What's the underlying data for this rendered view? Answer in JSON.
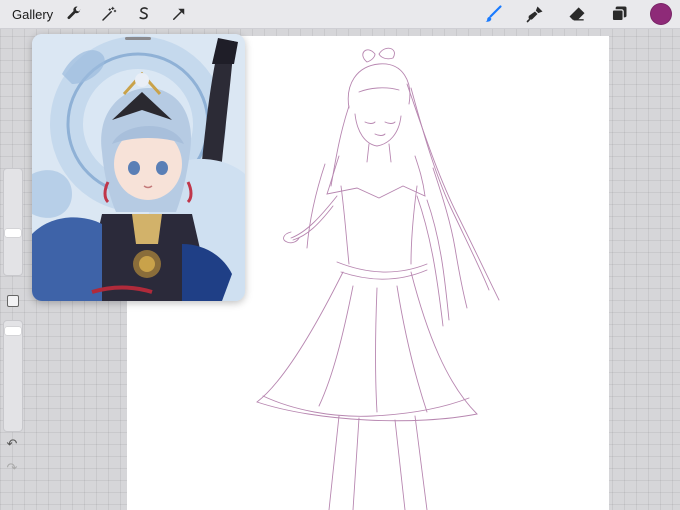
{
  "topbar": {
    "gallery_label": "Gallery",
    "left_tools": [
      {
        "name": "wrench-icon",
        "action": "actions"
      },
      {
        "name": "magic-wand-icon",
        "action": "adjustments"
      },
      {
        "name": "selection-s-icon",
        "action": "selection"
      },
      {
        "name": "arrow-cursor-icon",
        "action": "transform"
      }
    ],
    "right_tools": [
      {
        "name": "brush-icon",
        "active": true
      },
      {
        "name": "smudge-icon",
        "active": false
      },
      {
        "name": "eraser-icon",
        "active": false
      },
      {
        "name": "layers-icon",
        "active": false
      }
    ],
    "current_color": "#8e2a78"
  },
  "colors": {
    "accent_blue": "#1a7bff",
    "sketch_stroke": "#b07aa8"
  },
  "sidebar": {
    "undo_glyph": "↶",
    "redo_glyph": "↷"
  }
}
